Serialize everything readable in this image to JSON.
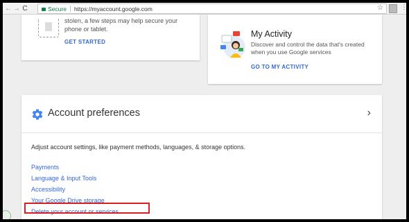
{
  "browser": {
    "back_icon": "arrow-left-icon",
    "forward_icon": "arrow-right-icon",
    "reload_icon": "reload-icon",
    "secure_label": "Secure",
    "url": "https://myaccount.google.com",
    "star_icon": "star-icon"
  },
  "security_card": {
    "text": "stolen, a few steps may help secure your phone or tablet.",
    "cta": "GET STARTED"
  },
  "activity_card": {
    "title": "My Activity",
    "description": "Discover and control the data that's created when you use Google services",
    "cta": "GO TO MY ACTIVITY"
  },
  "preferences": {
    "title": "Account preferences",
    "description": "Adjust account settings, like payment methods, languages, & storage options.",
    "links": [
      "Payments",
      "Language & Input Tools",
      "Accessibility",
      "Your Google Drive storage",
      "Delete your account or services"
    ]
  },
  "colors": {
    "link": "#3367d6",
    "secure": "#0b8043",
    "highlight": "#d91f26",
    "gear": "#4285f4"
  }
}
